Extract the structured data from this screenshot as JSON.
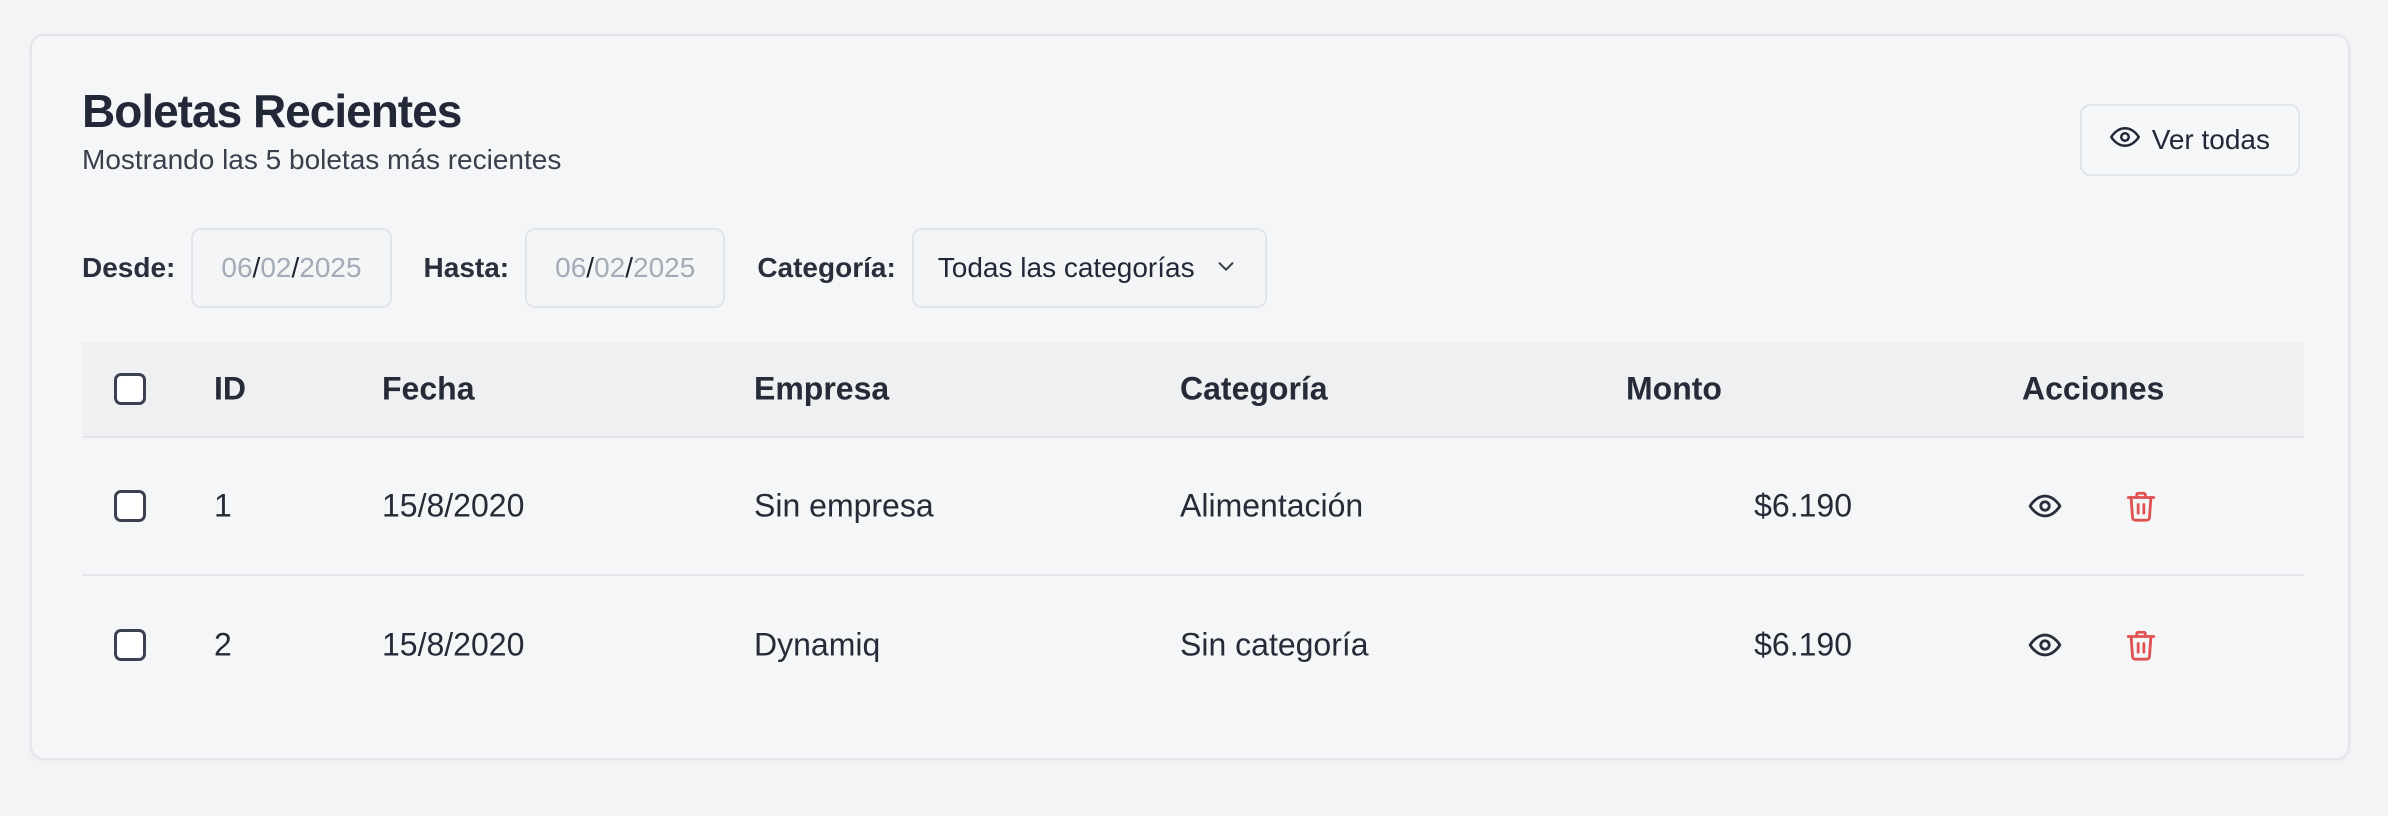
{
  "header": {
    "title": "Boletas Recientes",
    "subtitle": "Mostrando las 5 boletas más recientes",
    "view_all_label": "Ver todas",
    "view_all_icon": "eye-icon"
  },
  "filters": {
    "from_label": "Desde:",
    "from_date": {
      "dd": "06",
      "mm": "02",
      "yyyy": "2025"
    },
    "to_label": "Hasta:",
    "to_date": {
      "dd": "06",
      "mm": "02",
      "yyyy": "2025"
    },
    "category_label": "Categoría:",
    "category_selected": "Todas las categorías"
  },
  "table": {
    "columns": [
      "ID",
      "Fecha",
      "Empresa",
      "Categoría",
      "Monto",
      "Acciones"
    ],
    "rows": [
      {
        "id": "1",
        "fecha": "15/8/2020",
        "empresa": "Sin empresa",
        "categoria": "Alimentación",
        "monto": "$6.190"
      },
      {
        "id": "2",
        "fecha": "15/8/2020",
        "empresa": "Dynamiq",
        "categoria": "Sin categoría",
        "monto": "$6.190"
      }
    ],
    "action_icons": [
      "eye-icon",
      "trash-icon"
    ]
  },
  "colors": {
    "background": "#f3f4f6",
    "card": "#f5f6f8",
    "text": "#1f2433",
    "placeholder": "#a4abb8",
    "delete": "#e05252"
  }
}
